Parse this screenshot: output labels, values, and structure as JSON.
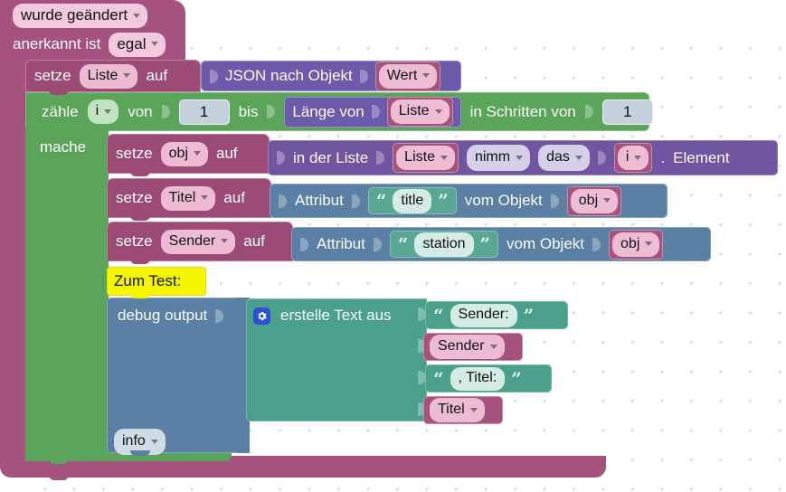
{
  "app": {
    "title": "Blockly Workspace",
    "background": "#fcfcfc",
    "grid": "dotted-cross"
  },
  "colors": {
    "event_magenta": "#a5537e",
    "loop_green": "#5ba55b",
    "object_purple": "#6c5bab",
    "list_purple": "#7055a0",
    "attribute_blue": "#5b80a5",
    "text_teal": "#4aa08a",
    "comment_yellow": "#f5f500"
  },
  "blocks": {
    "event": {
      "trigger_label": "wurde geändert",
      "ack_label": "anerkannt ist",
      "ack_value": "egal"
    },
    "set_liste": {
      "set_label": "setze",
      "variable": "Liste",
      "to_label": "auf",
      "value_block": {
        "label": "JSON nach Objekt",
        "argument": "Wert"
      }
    },
    "for_loop": {
      "count_label": "zähle",
      "variable": "i",
      "from_label": "von",
      "from_value": "1",
      "to_label": "bis",
      "to_block": {
        "label": "Länge von",
        "argument": "Liste"
      },
      "step_label": "in Schritten von",
      "step_value": "1",
      "do_label": "mache"
    },
    "set_obj": {
      "set_label": "setze",
      "variable": "obj",
      "to_label": "auf",
      "value_block": {
        "in_list_label": "in der Liste",
        "list_arg": "Liste",
        "take_label": "nimm",
        "which_label": "das",
        "index_arg": "i",
        "suffix_label": ".",
        "element_label": "Element"
      }
    },
    "set_titel": {
      "set_label": "setze",
      "variable": "Titel",
      "to_label": "auf",
      "value_block": {
        "attribute_label": "Attribut",
        "attribute_name": "title",
        "of_object_label": "vom Objekt",
        "object_arg": "obj"
      }
    },
    "set_sender": {
      "set_label": "setze",
      "variable": "Sender",
      "to_label": "auf",
      "value_block": {
        "attribute_label": "Attribut",
        "attribute_name": "station",
        "of_object_label": "vom Objekt",
        "object_arg": "obj"
      }
    },
    "comment": {
      "text": "Zum Test:"
    },
    "debug_output": {
      "label": "debug output",
      "level_field": "info",
      "value_block": {
        "label": "erstelle Text aus",
        "gear_icon": "gear-icon",
        "items": [
          {
            "kind": "text",
            "value": "Sender: "
          },
          {
            "kind": "variable",
            "value": "Sender"
          },
          {
            "kind": "text",
            "value": ", Titel: "
          },
          {
            "kind": "variable",
            "value": "Titel"
          }
        ]
      }
    }
  }
}
